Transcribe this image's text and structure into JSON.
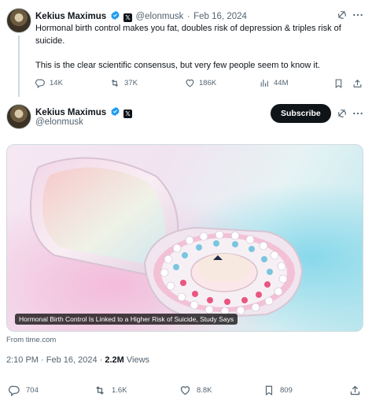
{
  "reply_tweet": {
    "author_name": "Kekius Maximus",
    "handle": "@elonmusk",
    "separator": "·",
    "date": "Feb 16, 2024",
    "text_line1": "Hormonal birth control makes you fat, doubles risk of depression & triples risk of",
    "text_line2": "suicide.",
    "text_line3": "This is the clear scientific consensus, but very few people seem to know it.",
    "actions": {
      "replies": "14K",
      "reposts": "37K",
      "likes": "186K",
      "views": "44M"
    }
  },
  "main_tweet": {
    "author_name": "Kekius Maximus",
    "handle": "@elonmusk",
    "subscribe_label": "Subscribe",
    "media_caption": "Hormonal Birth Control Is Linked to a Higher Risk of Suicide, Study Says",
    "source": "From time.com",
    "timestamp": "2:10 PM · Feb 16, 2024 ·",
    "views_count": "2.2M",
    "views_label": "Views",
    "actions": {
      "replies": "704",
      "reposts": "1.6K",
      "likes": "8.8K",
      "bookmarks": "809"
    }
  },
  "icons": [
    "verified-icon",
    "x-badge-icon",
    "grok-icon",
    "more-icon",
    "reply-icon",
    "repost-icon",
    "like-icon",
    "views-icon",
    "bookmark-icon",
    "share-icon"
  ],
  "colors": {
    "text": "#0f1419",
    "muted": "#536471",
    "verified": "#1d9bf0",
    "subscribe_bg": "#0f1419"
  }
}
